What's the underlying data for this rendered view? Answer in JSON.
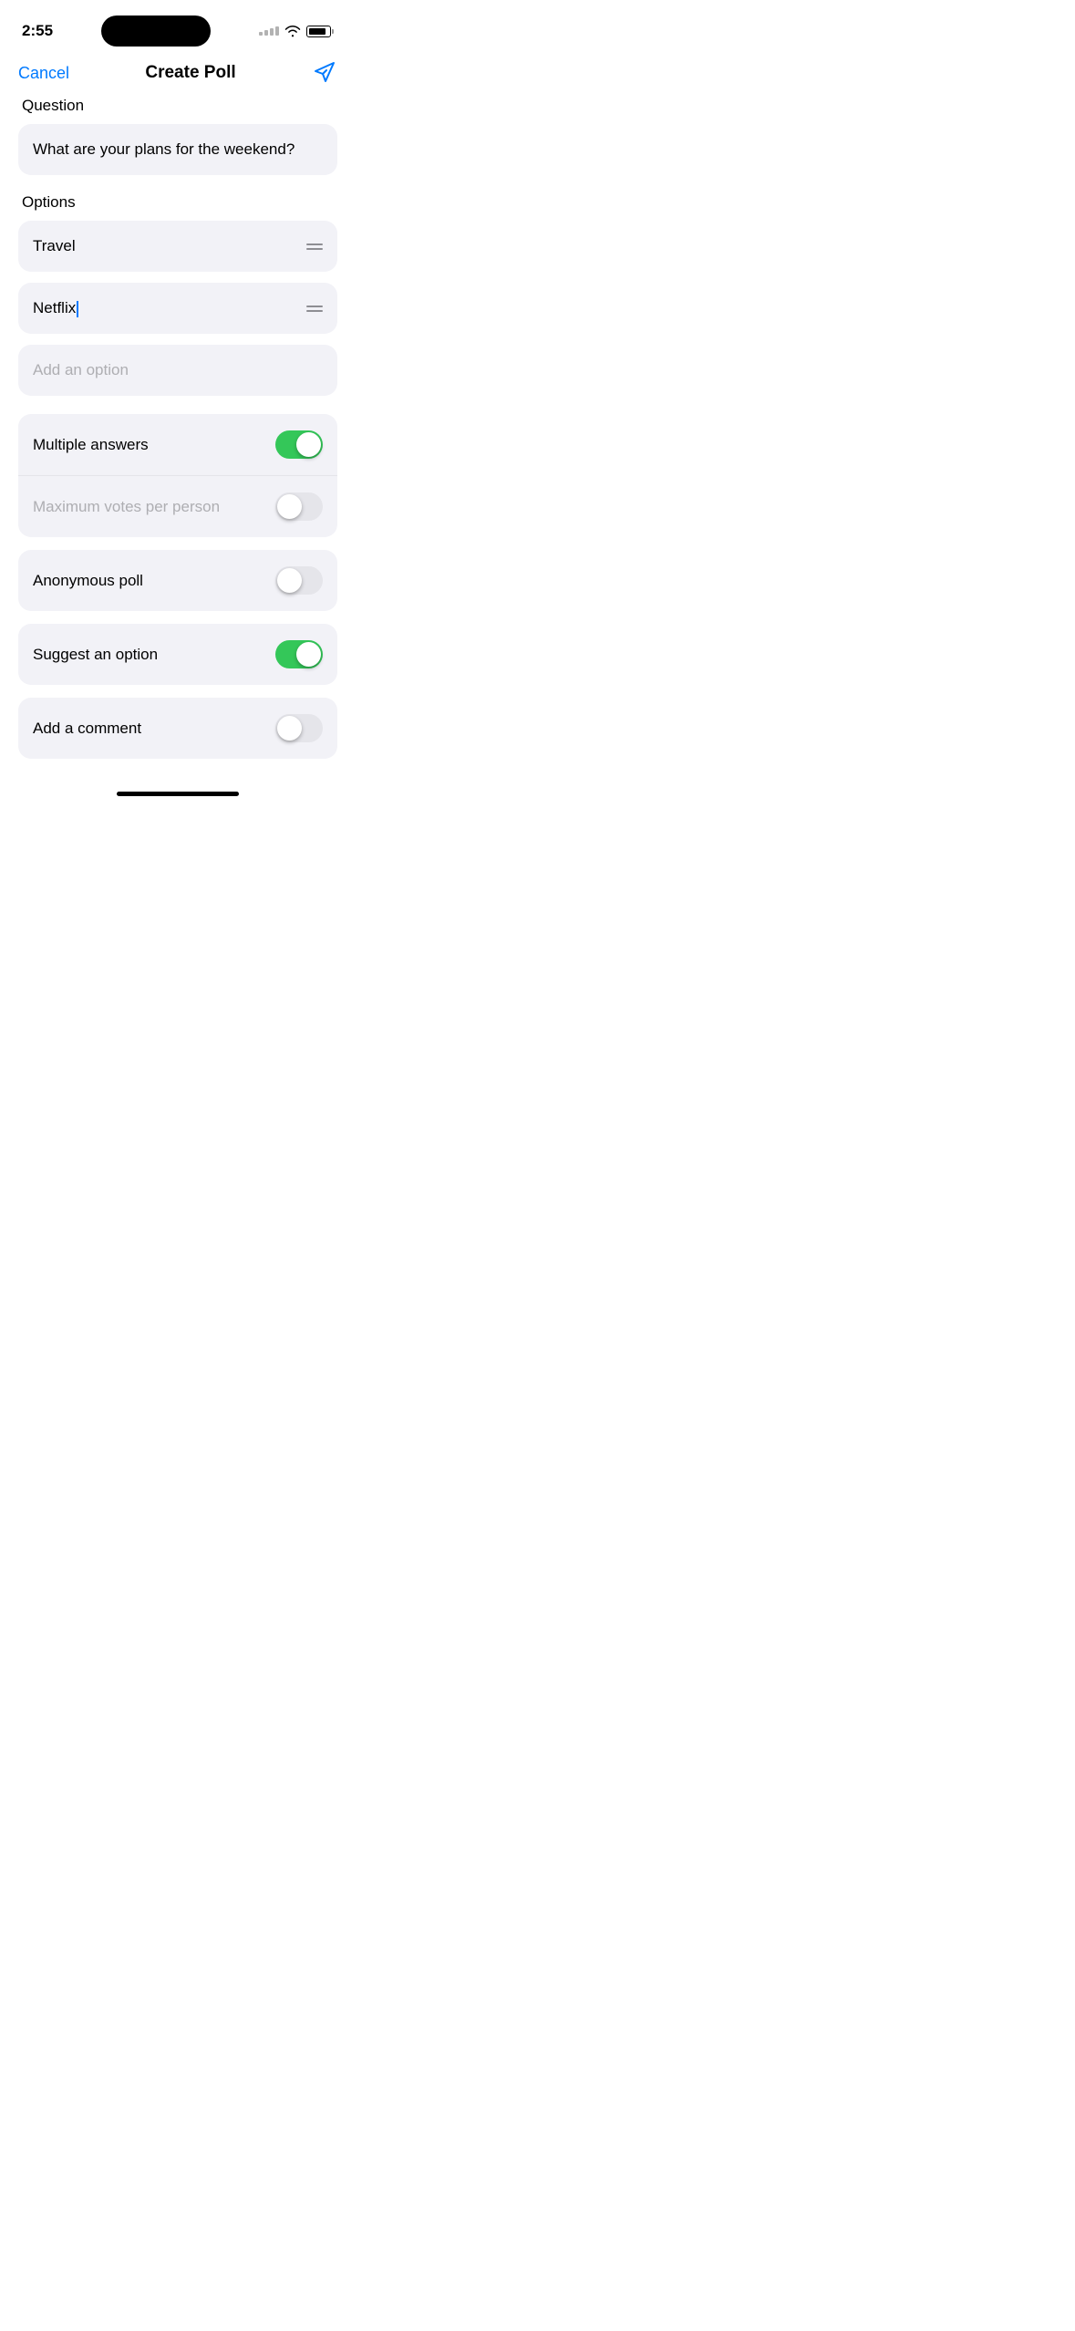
{
  "statusBar": {
    "time": "2:55"
  },
  "navBar": {
    "cancelLabel": "Cancel",
    "title": "Create Poll",
    "sendIconLabel": "send"
  },
  "question": {
    "label": "Question",
    "value": "What are your plans for the weekend?"
  },
  "options": {
    "label": "Options",
    "items": [
      {
        "value": "Travel",
        "hasHandle": true,
        "placeholder": false
      },
      {
        "value": "Netflix",
        "hasHandle": true,
        "placeholder": false,
        "hasCursor": true
      },
      {
        "value": "",
        "hasHandle": false,
        "placeholder": true
      }
    ],
    "placeholder": "Add an option"
  },
  "settings": {
    "groups": [
      {
        "rows": [
          {
            "label": "Multiple answers",
            "labelDisabled": false,
            "toggleOn": true
          },
          {
            "label": "Maximum votes per person",
            "labelDisabled": true,
            "toggleOn": false
          }
        ]
      },
      {
        "rows": [
          {
            "label": "Anonymous poll",
            "labelDisabled": false,
            "toggleOn": false
          }
        ]
      },
      {
        "rows": [
          {
            "label": "Suggest an option",
            "labelDisabled": false,
            "toggleOn": true
          }
        ]
      },
      {
        "rows": [
          {
            "label": "Add a comment",
            "labelDisabled": false,
            "toggleOn": false
          }
        ]
      }
    ]
  }
}
